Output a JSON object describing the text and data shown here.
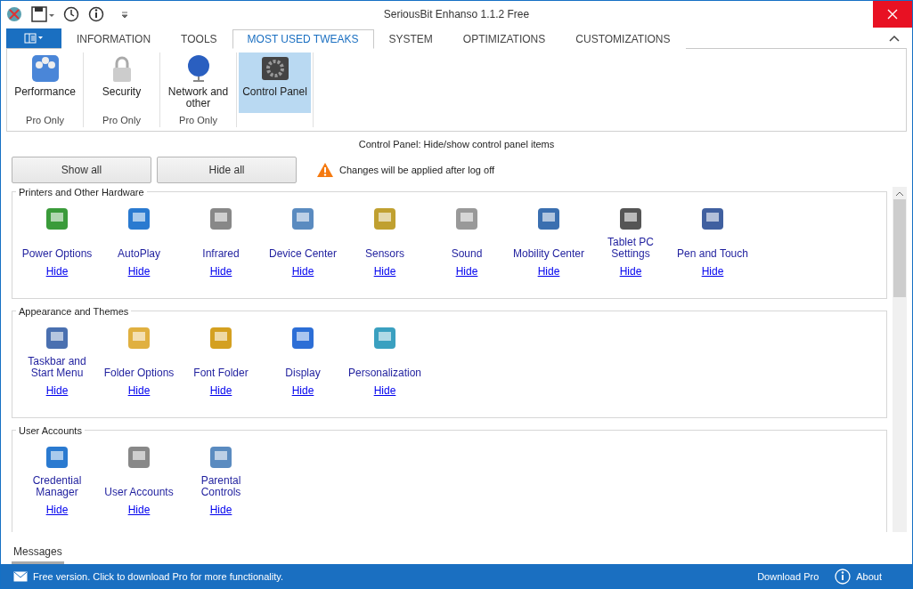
{
  "window": {
    "title": "SeriousBit Enhanso 1.1.2 Free"
  },
  "tabs": [
    {
      "label": "INFORMATION",
      "selected": false
    },
    {
      "label": "TOOLS",
      "selected": false
    },
    {
      "label": "MOST USED TWEAKS",
      "selected": true
    },
    {
      "label": "SYSTEM",
      "selected": false
    },
    {
      "label": "OPTIMIZATIONS",
      "selected": false
    },
    {
      "label": "CUSTOMIZATIONS",
      "selected": false
    }
  ],
  "ribbon": [
    {
      "kind": "gauges",
      "label": "Performance",
      "note": "Pro Only",
      "selected": false
    },
    {
      "kind": "lock",
      "label": "Security",
      "note": "Pro Only",
      "selected": false
    },
    {
      "kind": "globe",
      "label": "Network and other",
      "note": "Pro Only",
      "selected": false
    },
    {
      "kind": "gear",
      "label": "Control Panel",
      "selected": true
    }
  ],
  "caption": "Control Panel: Hide/show control panel items",
  "buttons": [
    "Show all",
    "Hide all"
  ],
  "warning": "Changes will be applied after log off",
  "groups": [
    {
      "title": "Printers and Other Hardware",
      "items": [
        {
          "label": "Power Options",
          "link": "Hide"
        },
        {
          "label": "AutoPlay",
          "link": "Hide"
        },
        {
          "label": "Infrared",
          "link": "Hide"
        },
        {
          "label": "Device Center",
          "link": "Hide"
        },
        {
          "label": "Sensors",
          "link": "Hide"
        },
        {
          "label": "Sound",
          "link": "Hide"
        },
        {
          "label": "Mobility Center",
          "link": "Hide"
        },
        {
          "label": "Tablet PC Settings",
          "link": "Hide"
        },
        {
          "label": "Pen and Touch",
          "link": "Hide"
        }
      ]
    },
    {
      "title": "Appearance and Themes",
      "items": [
        {
          "label": "Taskbar and Start Menu",
          "link": "Hide"
        },
        {
          "label": "Folder Options",
          "link": "Hide"
        },
        {
          "label": "Font Folder",
          "link": "Hide"
        },
        {
          "label": "Display",
          "link": "Hide"
        },
        {
          "label": "Personalization",
          "link": "Hide"
        }
      ]
    },
    {
      "title": "User Accounts",
      "items": [
        {
          "label": "Credential Manager",
          "link": "Hide"
        },
        {
          "label": "User Accounts",
          "link": "Hide"
        },
        {
          "label": "Parental Controls",
          "link": "Hide"
        }
      ]
    }
  ],
  "messages_tab": "Messages",
  "status": {
    "message": "Free version. Click to download Pro for more functionality.",
    "download": "Download Pro",
    "about": "About"
  }
}
